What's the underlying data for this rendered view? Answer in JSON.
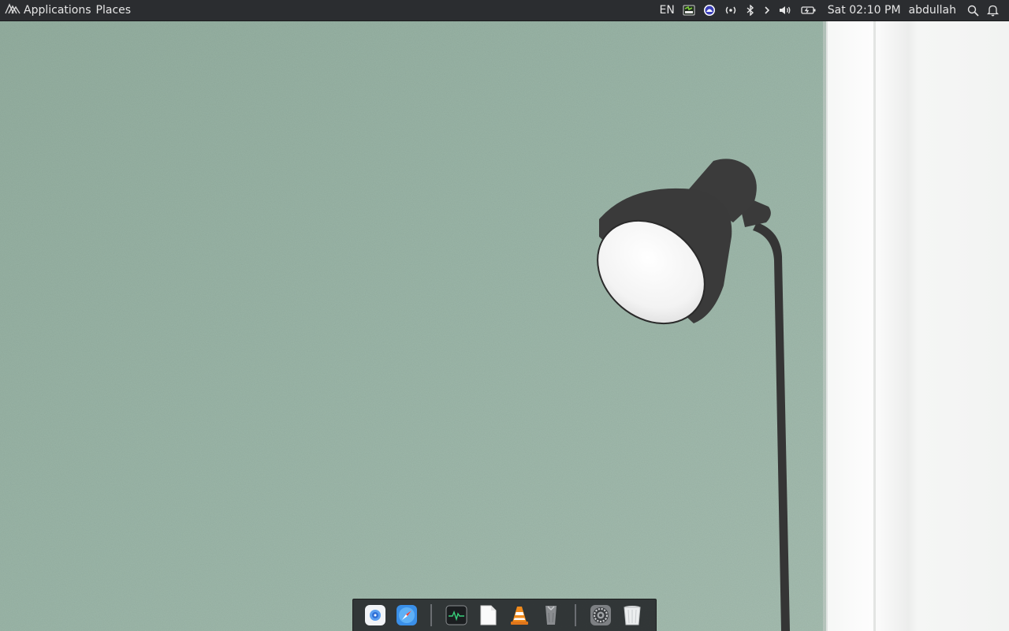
{
  "panel": {
    "applications_label": "Applications",
    "places_label": "Places",
    "keyboard_layout": "EN",
    "datetime": "Sat 02:10 PM",
    "username": "abdullah"
  },
  "dock": {
    "items": [
      {
        "name": "finder",
        "icon": "finder-icon"
      },
      {
        "name": "safari",
        "icon": "safari-compass-icon"
      },
      {
        "name": "activity-monitor",
        "icon": "activity-monitor-icon"
      },
      {
        "name": "text-editor",
        "icon": "blank-document-icon"
      },
      {
        "name": "vlc",
        "icon": "vlc-cone-icon"
      },
      {
        "name": "trash-can-app",
        "icon": "bin-icon"
      },
      {
        "name": "system-preferences",
        "icon": "gear-icon"
      },
      {
        "name": "trash",
        "icon": "trash-icon"
      }
    ]
  },
  "colors": {
    "panel_bg": "#2b2d30",
    "wall": "#9cb7a9",
    "lamp": "#353535",
    "dock_bg": "#282b2e"
  }
}
